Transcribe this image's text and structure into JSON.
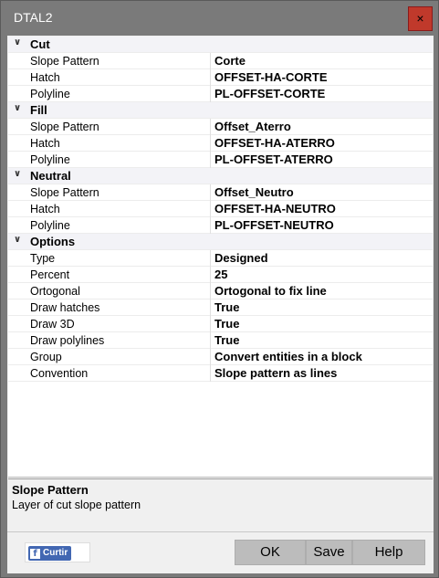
{
  "window": {
    "title": "DTAL2",
    "close_label": "×"
  },
  "categories": [
    {
      "name": "Cut",
      "rows": [
        {
          "label": "Slope Pattern",
          "value": "Corte"
        },
        {
          "label": "Hatch",
          "value": "OFFSET-HA-CORTE"
        },
        {
          "label": "Polyline",
          "value": "PL-OFFSET-CORTE"
        }
      ]
    },
    {
      "name": "Fill",
      "rows": [
        {
          "label": "Slope Pattern",
          "value": "Offset_Aterro"
        },
        {
          "label": "Hatch",
          "value": "OFFSET-HA-ATERRO"
        },
        {
          "label": "Polyline",
          "value": "PL-OFFSET-ATERRO"
        }
      ]
    },
    {
      "name": "Neutral",
      "rows": [
        {
          "label": "Slope Pattern",
          "value": "Offset_Neutro"
        },
        {
          "label": "Hatch",
          "value": "OFFSET-HA-NEUTRO"
        },
        {
          "label": "Polyline",
          "value": "PL-OFFSET-NEUTRO"
        }
      ]
    },
    {
      "name": "Options",
      "rows": [
        {
          "label": "Type",
          "value": "Designed"
        },
        {
          "label": "Percent",
          "value": "25"
        },
        {
          "label": "Ortogonal",
          "value": "Ortogonal to fix line"
        },
        {
          "label": "Draw hatches",
          "value": "True"
        },
        {
          "label": "Draw 3D",
          "value": "True"
        },
        {
          "label": "Draw polylines",
          "value": "True"
        },
        {
          "label": "Group",
          "value": "Convert entities in a block"
        },
        {
          "label": "Convention",
          "value": "Slope pattern as lines"
        }
      ]
    }
  ],
  "description": {
    "title": "Slope Pattern",
    "text": "Layer of cut slope pattern"
  },
  "footer": {
    "facebook_label": "Curtir",
    "facebook_icon": "f",
    "ok_label": "OK",
    "save_label": "Save",
    "help_label": "Help"
  },
  "icons": {
    "expanded": "chevron-down-icon"
  }
}
